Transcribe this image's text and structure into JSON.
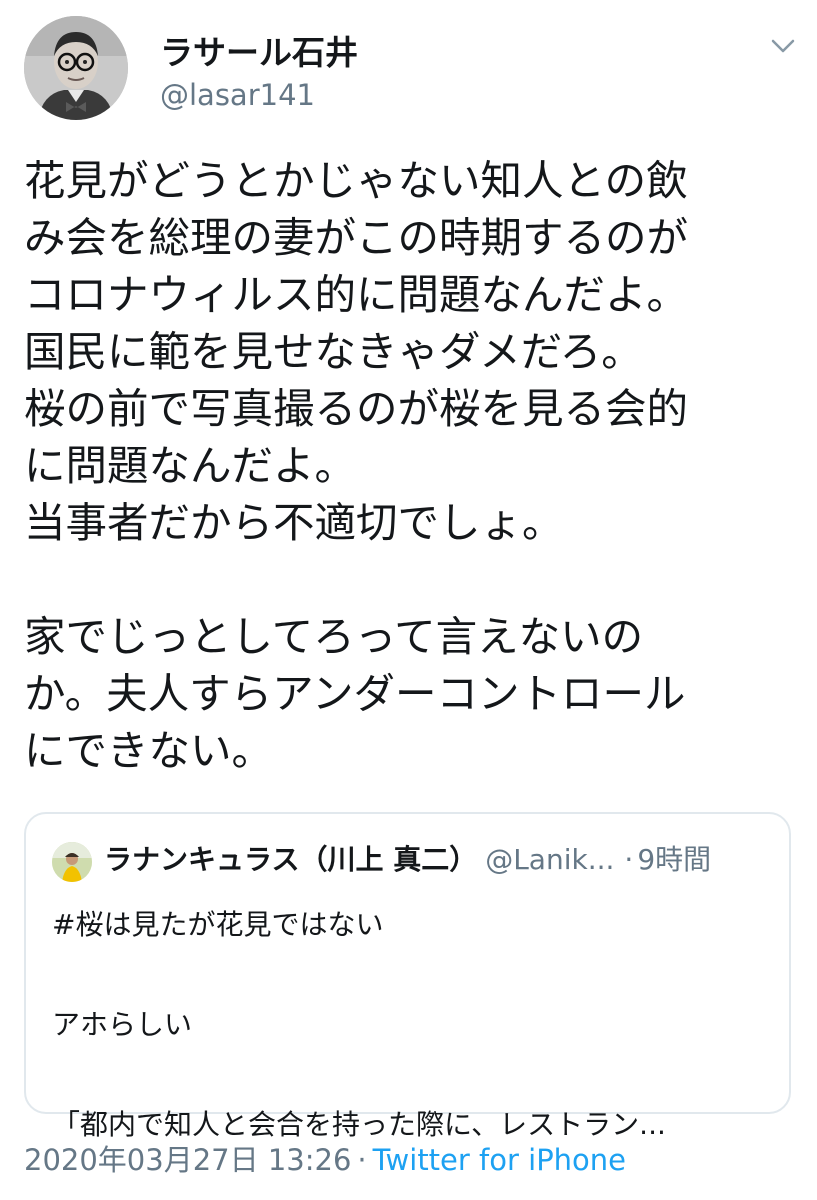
{
  "tweet": {
    "author": {
      "display_name": "ラサール石井",
      "handle": "@lasar141",
      "avatar_icon": "profile-photo-grayscale-man-glasses"
    },
    "menu_icon": "chevron-down-icon",
    "text_lines": [
      "花見がどうとかじゃない知人との飲",
      "み会を総理の妻がこの時期するのが",
      "コロナウィルス的に問題なんだよ。",
      "国民に範を見せなきゃダメだろ。",
      "桜の前で写真撮るのが桜を見る会的",
      "に問題なんだよ。",
      "当事者だから不適切でしょ。",
      "",
      "家でじっとしてろって言えないの",
      "か。夫人すらアンダーコントロール",
      "にできない。"
    ]
  },
  "quoted_tweet": {
    "display_name": "ラナンキュラス（川上 真二）",
    "handle": "@Lanik...",
    "separator": "·",
    "time": "9時間",
    "text_lines": [
      "#桜は見たが花見ではない",
      "",
      "アホらしい",
      "",
      "「都内で知人と会合を持った際に、レストラン..."
    ]
  },
  "footer": {
    "timestamp": "2020年03月27日 13:26",
    "separator": "·",
    "source": "Twitter for iPhone"
  },
  "colors": {
    "text": "#14171a",
    "secondary": "#657786",
    "link": "#1da1f2",
    "border": "#e1e8ed"
  }
}
